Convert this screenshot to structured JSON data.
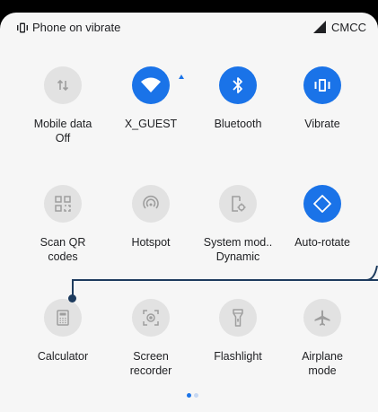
{
  "status_bar": {
    "vibrate_text": "Phone on vibrate",
    "carrier": "CMCC",
    "icons": [
      "vibrate-icon",
      "signal-icon"
    ]
  },
  "tiles": [
    {
      "name": "mobile-data",
      "label": "Mobile data\nOff",
      "state": "off",
      "icon": "mobile-data-icon"
    },
    {
      "name": "wifi",
      "label": "X_GUEST",
      "state": "on",
      "icon": "wifi-icon"
    },
    {
      "name": "bluetooth",
      "label": "Bluetooth",
      "state": "on",
      "icon": "bluetooth-icon"
    },
    {
      "name": "vibrate",
      "label": "Vibrate",
      "state": "on",
      "icon": "vibrate-icon"
    },
    {
      "name": "scan-qr",
      "label": "Scan QR\ncodes",
      "state": "off",
      "icon": "qr-code-icon"
    },
    {
      "name": "hotspot",
      "label": "Hotspot",
      "state": "off",
      "icon": "hotspot-icon"
    },
    {
      "name": "system-mode",
      "label": "System mod..\nDynamic",
      "state": "off",
      "icon": "system-mode-icon"
    },
    {
      "name": "auto-rotate",
      "label": "Auto-rotate",
      "state": "on",
      "icon": "auto-rotate-icon"
    },
    {
      "name": "calculator",
      "label": "Calculator",
      "state": "off",
      "icon": "calculator-icon"
    },
    {
      "name": "screen-recorder",
      "label": "Screen\nrecorder",
      "state": "off",
      "icon": "screen-recorder-icon"
    },
    {
      "name": "flashlight",
      "label": "Flashlight",
      "state": "off",
      "icon": "flashlight-icon"
    },
    {
      "name": "airplane",
      "label": "Airplane\nmode",
      "state": "off",
      "icon": "airplane-icon"
    }
  ],
  "colors": {
    "accent": "#1a73e8",
    "tile_off": "#e2e2e2",
    "icon_off": "#9e9e9e",
    "panel": "#f6f6f6"
  },
  "pager": {
    "pages": 2,
    "active": 0
  }
}
